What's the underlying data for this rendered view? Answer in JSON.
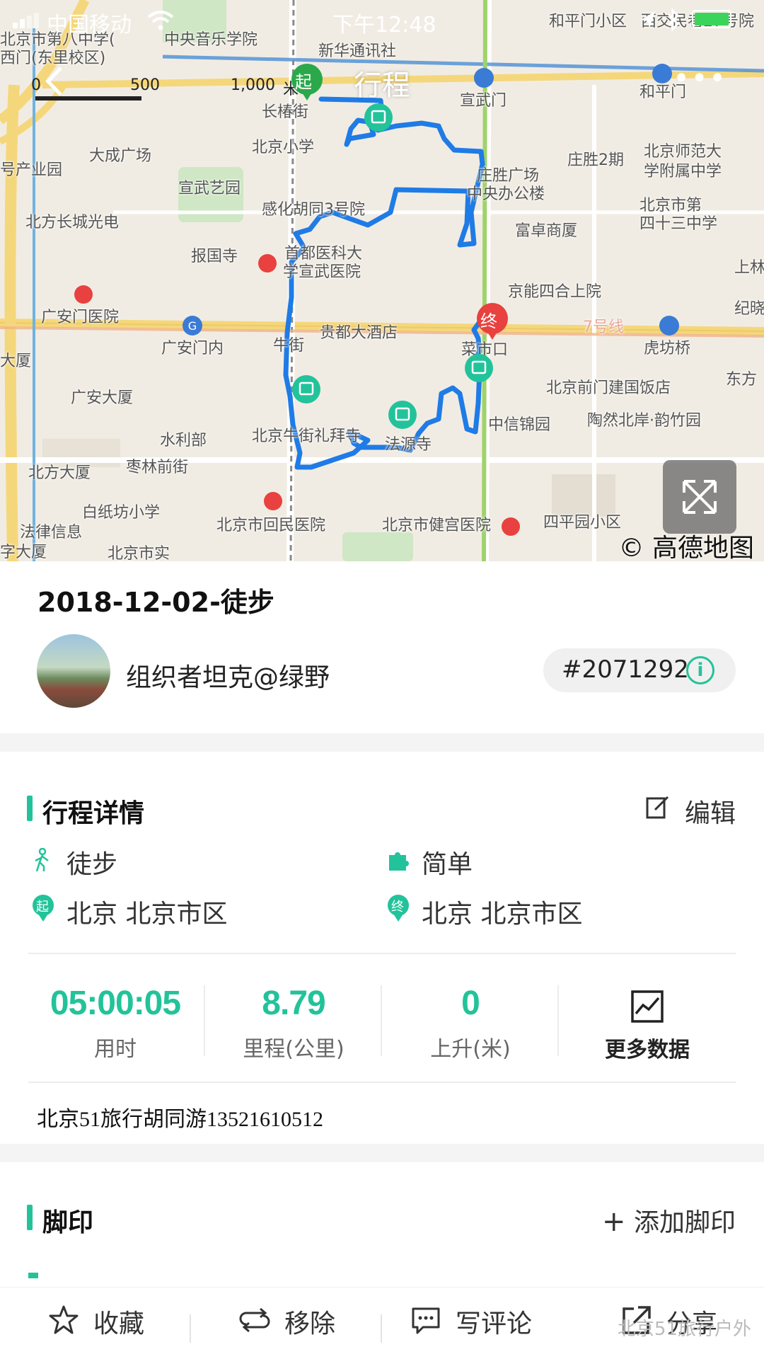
{
  "status_bar": {
    "carrier": "中国移动",
    "time": "下午12:48"
  },
  "navbar": {
    "title": "行程",
    "more": "•••"
  },
  "map": {
    "scale_labels": [
      "0",
      "500",
      "1,000",
      "米"
    ],
    "start_label": "起",
    "end_label": "终",
    "copyright": "© 高德地图",
    "pois": [
      "和平门小区",
      "西交民巷27号院",
      "北京市第八中学(",
      "西门(东里校区)",
      "中央音乐学院",
      "新华通讯社",
      "宣武门",
      "和平门",
      "长椿街",
      "大成广场",
      "北京小学",
      "庄胜2期",
      "北京师范大",
      "学附属中学",
      "号产业园",
      "宣武艺园",
      "庄胜广场",
      "中央办公楼",
      "北京市第",
      "四十三中学",
      "感化胡同3号院",
      "北方长城光电",
      "富卓商厦",
      "报国寺",
      "首都医科大",
      "学宣武医院",
      "京能四合上院",
      "上林",
      "广安门医院",
      "纪晓",
      "贵都大酒店",
      "7号线",
      "广安门内",
      "牛街",
      "菜市口",
      "虎坊桥",
      "东方",
      "北京前门建国饭店",
      "大厦",
      "广安大厦",
      "中信锦园",
      "陶然北岸·韵竹园",
      "水利部",
      "北京牛街礼拜寺",
      "法源寺",
      "北方大厦",
      "枣林前街",
      "白纸坊小学",
      "四平园小区",
      "法律信息",
      "北京市回民医院",
      "北京市健宫医院",
      "字大厦",
      "北京市实"
    ]
  },
  "trip": {
    "title": "2018-12-02-徒步",
    "organizer": "组织者坦克@绿野",
    "id": "#2071292",
    "info_icon_label": "i"
  },
  "details": {
    "section_title": "行程详情",
    "edit_label": "编辑",
    "activity": "徒步",
    "difficulty": "简单",
    "start_location": "北京 北京市区",
    "end_location": "北京 北京市区",
    "start_marker": "起",
    "end_marker": "终"
  },
  "stats": {
    "duration": {
      "value": "05:00:05",
      "label": "用时"
    },
    "distance": {
      "value": "8.79",
      "label": "里程(公里)"
    },
    "ascent": {
      "value": "0",
      "label": "上升(米)"
    },
    "more_label": "更多数据"
  },
  "note": "北京51旅行胡同游13521610512",
  "footprint": {
    "section_title": "脚印",
    "add_label": "添加脚印"
  },
  "tabbar": {
    "favorite": "收藏",
    "remove": "移除",
    "comment": "写评论",
    "share": "分享",
    "watermark": "北京51旅行户外"
  },
  "colors": {
    "accent": "#22c39a",
    "track": "#1f7be6",
    "start_pin": "#2aa84a",
    "end_pin": "#e8413f"
  }
}
